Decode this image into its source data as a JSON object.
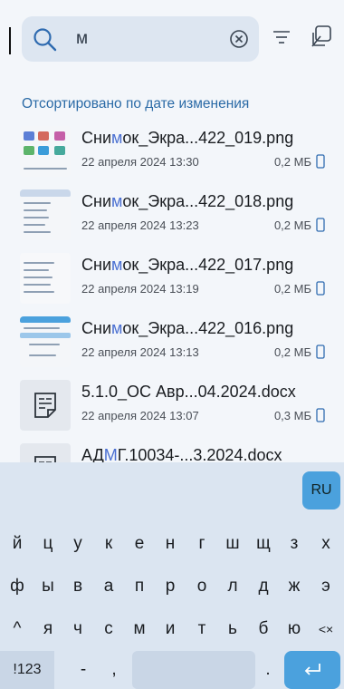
{
  "search": {
    "query": "м",
    "clear_icon": "clear-icon",
    "filter_icon": "filter-icon",
    "open_icon": "open-in-icon"
  },
  "sort_label": "Отсортировано по дате изменения",
  "files": [
    {
      "name_pre": "Сни",
      "name_match": "м",
      "name_post": "ок_Экра...422_019.png",
      "date": "22 апреля 2024 13:30",
      "size": "0,2 МБ",
      "type": "image"
    },
    {
      "name_pre": "Сни",
      "name_match": "м",
      "name_post": "ок_Экра...422_018.png",
      "date": "22 апреля 2024 13:23",
      "size": "0,2 МБ",
      "type": "image"
    },
    {
      "name_pre": "Сни",
      "name_match": "м",
      "name_post": "ок_Экра...422_017.png",
      "date": "22 апреля 2024 13:19",
      "size": "0,2 МБ",
      "type": "image"
    },
    {
      "name_pre": "Сни",
      "name_match": "м",
      "name_post": "ок_Экра...422_016.png",
      "date": "22 апреля 2024 13:13",
      "size": "0,2 МБ",
      "type": "image"
    },
    {
      "name_pre": "5.1.0_ОС Авр...04.2024.docx",
      "name_match": "",
      "name_post": "",
      "date": "22 апреля 2024 13:07",
      "size": "0,3 МБ",
      "type": "doc"
    },
    {
      "name_pre": "АД",
      "name_match": "М",
      "name_post": "Г.10034-...3.2024.docx",
      "date": "",
      "size": "",
      "type": "doc"
    }
  ],
  "colors": {
    "accent": "#4ba1dd",
    "match_highlight": "#4a6fd1",
    "sort_label": "#2a6aa6"
  },
  "keyboard": {
    "lang": "RU",
    "row1": [
      "й",
      "ц",
      "у",
      "к",
      "е",
      "н",
      "г",
      "ш",
      "щ",
      "з",
      "х"
    ],
    "row2": [
      "ф",
      "ы",
      "в",
      "а",
      "п",
      "р",
      "о",
      "л",
      "д",
      "ж",
      "э"
    ],
    "row3": [
      "^",
      "я",
      "ч",
      "с",
      "м",
      "и",
      "т",
      "ь",
      "б",
      "ю",
      "<×"
    ],
    "symbols": "!123",
    "dash": "-",
    "comma": ",",
    "dot": "."
  }
}
